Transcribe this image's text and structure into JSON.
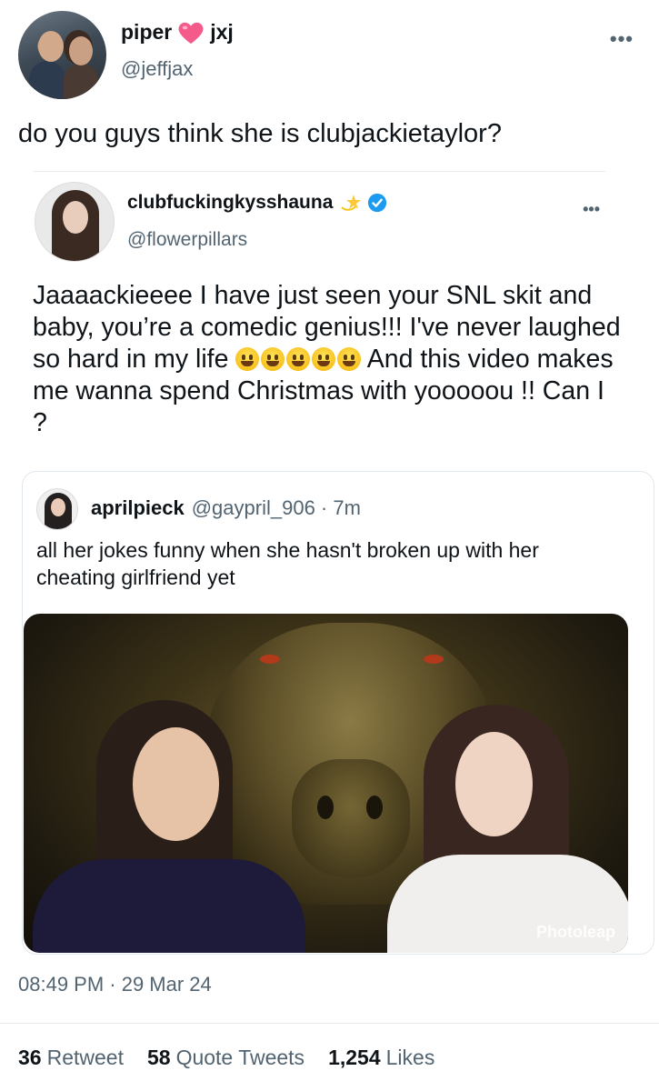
{
  "author": {
    "name_part1": "piper",
    "name_emoji_icon": "pink-heart-icon",
    "name_part2": "jxj",
    "handle": "@jeffjax"
  },
  "tweet_text": "do you guys think she is clubjackietaylor?",
  "quoted": {
    "name": "clubfuckingkysshauna",
    "name_emoji_icon": "dizzy-star-icon",
    "verified_icon": "verified-badge-icon",
    "handle": "@flowerpillars",
    "text_part1": "Jaaaackieeee I have just seen your SNL skit and baby, you’re a comedic genius!!! I've never laughed so hard in my life",
    "emoji_icons": [
      "smiley-icon",
      "rofl-icon",
      "joy-icon",
      "grin-icon",
      "beaming-icon"
    ],
    "text_part2": "And this video makes me wanna spend Christmas with yooooou !!  Can I ?",
    "inner": {
      "name": "aprilpieck",
      "handle_time": "@gaypril_906 · 7m",
      "text": "all her jokes funny when she hasn't broken up with her cheating girlfriend yet",
      "media_watermark": "Photoleap"
    }
  },
  "timestamp": "08:49 PM · 29 Mar 24",
  "stats": {
    "retweets": "36",
    "retweets_label": "Retweet",
    "quotes": "58",
    "quotes_label": "Quote Tweets",
    "likes": "1,254",
    "likes_label": "Likes"
  },
  "colors": {
    "secondary_text": "#536471",
    "verified_blue": "#1d9bf0",
    "heart_pink": "#f45a8a"
  }
}
